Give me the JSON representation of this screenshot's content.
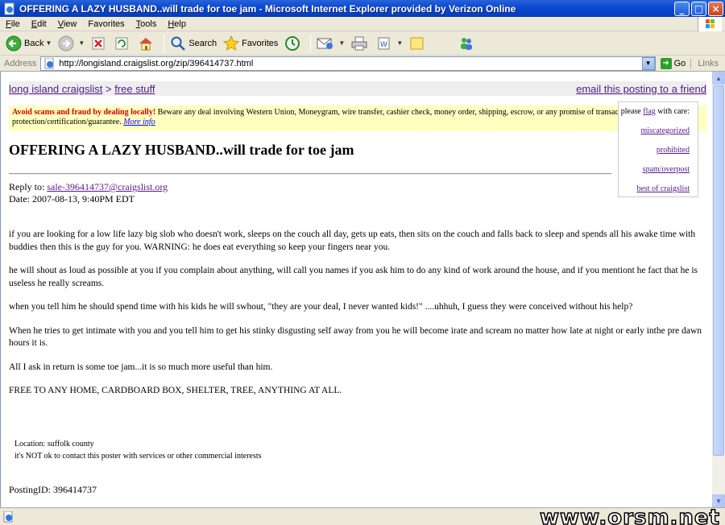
{
  "window": {
    "title": "OFFERING A LAZY HUSBAND..will trade for toe jam - Microsoft Internet Explorer provided by Verizon Online",
    "minimize": "_",
    "maximize": "□",
    "close": "×"
  },
  "menu": {
    "items": [
      {
        "ul": "F",
        "rest": "ile"
      },
      {
        "ul": "E",
        "rest": "dit"
      },
      {
        "ul": "V",
        "rest": "iew"
      },
      {
        "ul": "F",
        "rest": "avorites",
        "prefix": ""
      },
      {
        "ul": "T",
        "rest": "ools"
      },
      {
        "ul": "H",
        "rest": "elp"
      }
    ]
  },
  "toolbar": {
    "back": "Back",
    "search": "Search",
    "favorites": "Favorites"
  },
  "address": {
    "label": "Address",
    "url": "http://longisland.craigslist.org/zip/396414737.html",
    "go": "Go",
    "links": "Links"
  },
  "nav": {
    "site": "long island craigslist",
    "sep": ">",
    "section": "free stuff",
    "email": "email this posting to a friend"
  },
  "warning": {
    "strong": "Avoid scams and fraud by dealing locally!",
    "text": " Beware any deal involving Western Union, Moneygram, wire transfer, cashier check, money order, shipping, escrow, or any promise of transaction protection/certification/guarantee. ",
    "more": "More info"
  },
  "flag": {
    "please": "please ",
    "flag": "flag",
    "with_care": " with care:",
    "items": [
      "miscategorized",
      "prohibited",
      "spam/overpost",
      "best of craigslist"
    ]
  },
  "posting": {
    "title": "OFFERING A LAZY HUSBAND..will trade for toe jam",
    "reply_label": "Reply to: ",
    "reply_email": "sale-396414737@craigslist.org",
    "date": "Date: 2007-08-13, 9:40PM EDT",
    "paragraphs": [
      "if you are looking for a low life lazy big slob who doesn't work, sleeps on the couch all day, gets up eats, then sits on the couch and falls back to sleep and spends all his awake time with buddies then this is the guy for you. WARNING: he does eat everything so keep your fingers near you.",
      "he will shout as loud as possible at you if you complain about anything, will call you names if you ask him to do any kind of work around the house, and if you mentiont he fact that he is useless he really screams.",
      "when you tell him he should spend time with his kids he will swhout, \"they are your deal, I never wanted kids!\" ....uhhuh, I guess they were conceived without his help?",
      "When he tries to get intimate with you and you tell him to get his stinky disgusting self away from you he will become irate and scream no matter how late at night or early inthe pre dawn hours it is.",
      "All I ask in return is some toe jam...it is so much more useful than him.",
      "FREE TO ANY HOME, CARDBOARD BOX, SHELTER, TREE, ANYTHING AT ALL."
    ],
    "location": "Location: suffolk county",
    "contact_note": "it's NOT ok to contact this poster with services or other commercial interests",
    "posting_id": "PostingID: 396414737"
  },
  "watermark": "www.orsm.net"
}
